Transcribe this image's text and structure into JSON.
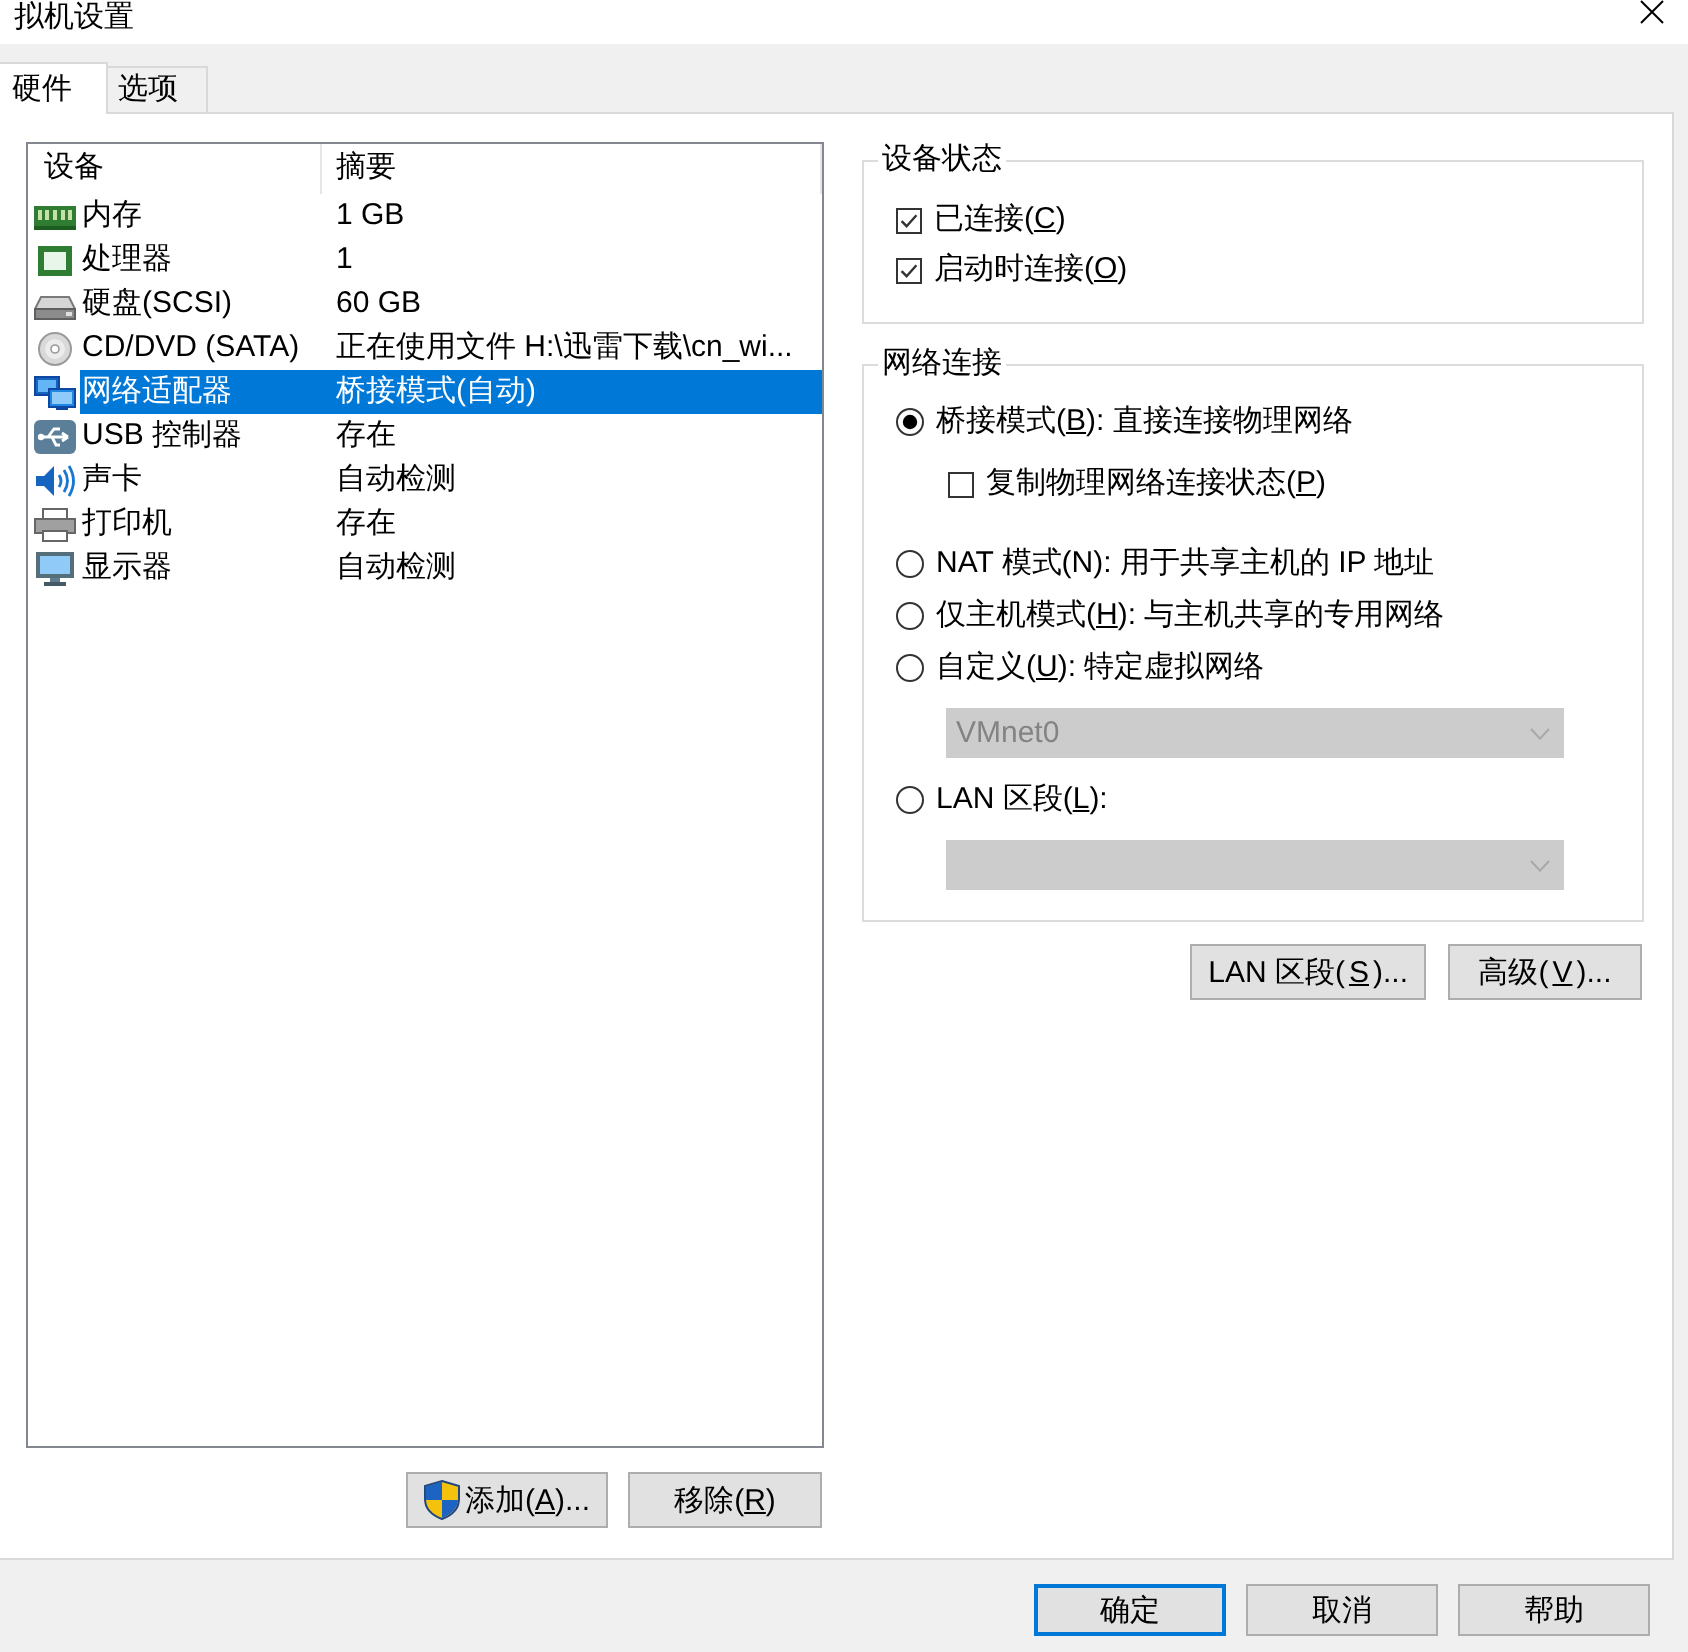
{
  "window": {
    "title": "拟机设置"
  },
  "tabs": [
    {
      "label": "硬件",
      "selected": true
    },
    {
      "label": "选项",
      "selected": false
    }
  ],
  "device_list": {
    "columns": [
      "设备",
      "摘要"
    ],
    "rows": [
      {
        "kind": "memory",
        "device": "内存",
        "summary": "1 GB",
        "selected": false
      },
      {
        "kind": "cpu",
        "device": "处理器",
        "summary": "1",
        "selected": false
      },
      {
        "kind": "disk",
        "device": "硬盘(SCSI)",
        "summary": "60 GB",
        "selected": false
      },
      {
        "kind": "cdrom",
        "device": "CD/DVD (SATA)",
        "summary": "正在使用文件 H:\\迅雷下载\\cn_wi...",
        "selected": false
      },
      {
        "kind": "network",
        "device": "网络适配器",
        "summary": "桥接模式(自动)",
        "selected": true
      },
      {
        "kind": "usb",
        "device": "USB 控制器",
        "summary": "存在",
        "selected": false
      },
      {
        "kind": "sound",
        "device": "声卡",
        "summary": "自动检测",
        "selected": false
      },
      {
        "kind": "printer",
        "device": "打印机",
        "summary": "存在",
        "selected": false
      },
      {
        "kind": "display",
        "device": "显示器",
        "summary": "自动检测",
        "selected": false
      }
    ]
  },
  "device_buttons": [
    {
      "kind": "elevated",
      "text": "添加(",
      "hotkey": "A",
      "after": ")..."
    },
    {
      "kind": "plain",
      "text": "移除(",
      "hotkey": "R",
      "after": ")"
    }
  ],
  "device_status": {
    "title": "设备状态",
    "options": [
      {
        "text": "已连接(",
        "hotkey": "C",
        "after": ")",
        "checked": true
      },
      {
        "text": "启动时连接(",
        "hotkey": "O",
        "after": ")",
        "checked": true
      }
    ]
  },
  "network_connection": {
    "title": "网络连接",
    "options": [
      {
        "kind": "radio",
        "text": "桥接模式(",
        "hotkey": "B",
        "after": "): 直接连接物理网络",
        "selected": true
      },
      {
        "kind": "checkbox",
        "text": "复制物理网络连接状态(",
        "hotkey": "P",
        "after": ")",
        "checked": false
      },
      {
        "kind": "radio",
        "text": "NAT 模式(N): 用于共享主机的 IP 地址",
        "selected": false
      },
      {
        "kind": "radio",
        "text": "仅主机模式(",
        "hotkey": "H",
        "after": "): 与主机共享的专用网络",
        "selected": false
      },
      {
        "kind": "radio",
        "text": "自定义(",
        "hotkey": "U",
        "after": "): 特定虚拟网络",
        "selected": false
      },
      {
        "kind": "dropdown",
        "value": "VMnet0",
        "disabled": true
      },
      {
        "kind": "radio",
        "text": "LAN 区段(",
        "hotkey": "L",
        "after": "):",
        "selected": false
      },
      {
        "kind": "dropdown",
        "disabled": true
      }
    ]
  },
  "network_buttons": [
    {
      "text": "LAN 区段(",
      "hotkey": "S",
      "after": ")..."
    },
    {
      "text": "高级(",
      "hotkey": "V",
      "after": ")..."
    }
  ],
  "dialog_buttons": [
    {
      "text": "确定",
      "default": true
    },
    {
      "text": "取消",
      "default": false
    },
    {
      "text": "帮助",
      "default": false
    }
  ]
}
